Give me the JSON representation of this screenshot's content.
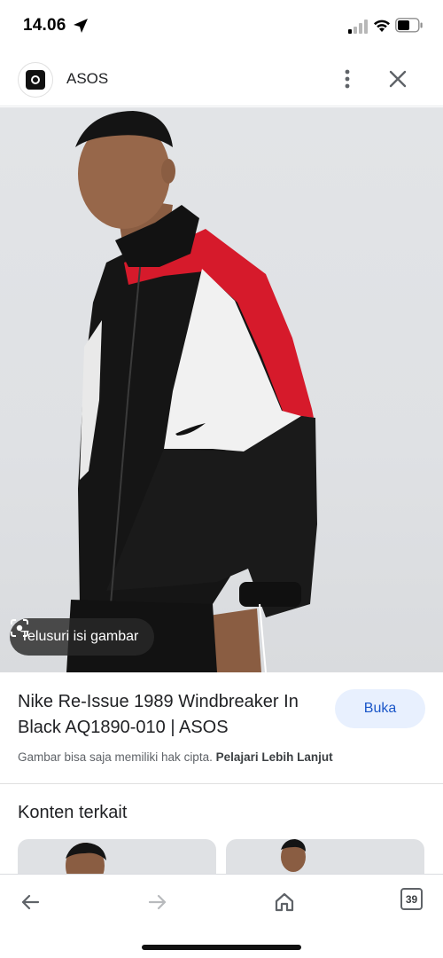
{
  "status_bar": {
    "time": "14.06",
    "icons": [
      "location-arrow-icon",
      "cellular-signal-icon",
      "wifi-icon",
      "battery-icon"
    ]
  },
  "site_header": {
    "site_name": "ASOS",
    "logo_icon": "asos-logo-icon",
    "more_icon": "more-vertical-icon",
    "close_icon": "close-icon"
  },
  "image": {
    "lens_chip_label": "Telusuri isi gambar",
    "lens_icon": "lens-icon"
  },
  "product": {
    "title": "Nike Re-Issue 1989 Windbreaker In Black AQ1890-010 | ASOS",
    "open_button": "Buka",
    "copyright_text": "Gambar bisa saja memiliki hak cipta.",
    "learn_more": "Pelajari Lebih Lanjut"
  },
  "related": {
    "heading": "Konten terkait"
  },
  "toolbar": {
    "back_icon": "back-arrow-icon",
    "forward_icon": "forward-arrow-icon",
    "home_icon": "home-icon",
    "tab_count": "39"
  },
  "colors": {
    "accent_blue": "#1a56c8",
    "button_bg": "#e8f0fe",
    "jacket_red": "#d61a2b",
    "jacket_black": "#151515"
  }
}
